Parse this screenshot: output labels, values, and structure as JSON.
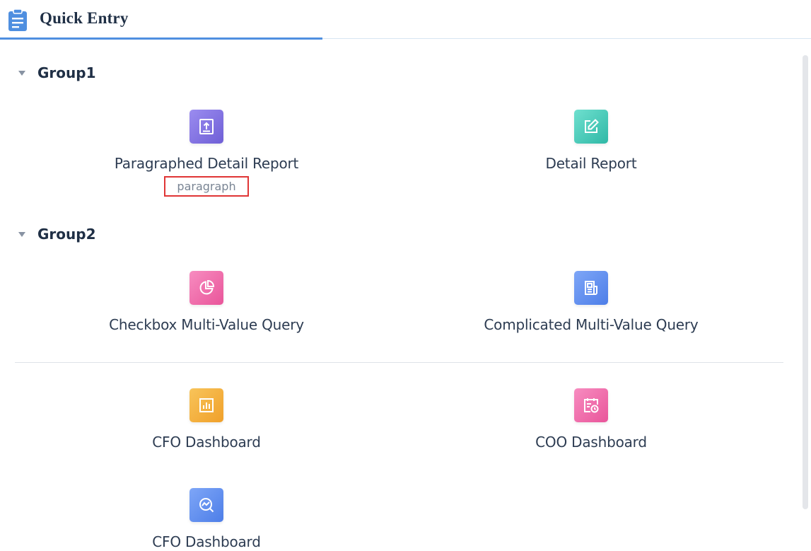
{
  "header": {
    "title": "Quick Entry",
    "icon": "clipboard-list-icon",
    "accent": "#4f8fe0"
  },
  "groups": [
    {
      "label": "Group1",
      "items": [
        {
          "name": "Paragraphed Detail Report",
          "tag": "paragraph",
          "icon": "upload-icon",
          "color": "#7c6fe0"
        },
        {
          "name": "Detail Report",
          "icon": "edit-icon",
          "color": "#3ec9b8"
        }
      ]
    },
    {
      "label": "Group2",
      "items": [
        {
          "name": "Checkbox Multi-Value Query",
          "icon": "pie-chart-icon",
          "color": "#f06aa8"
        },
        {
          "name": "Complicated Multi-Value Query",
          "icon": "newspaper-icon",
          "color": "#5b8cf0"
        }
      ]
    }
  ],
  "ungrouped": [
    {
      "name": "CFO Dashboard",
      "icon": "bar-chart-icon",
      "color": "#f5b03c"
    },
    {
      "name": "COO Dashboard",
      "icon": "calendar-clock-icon",
      "color": "#f06aa8"
    },
    {
      "name": "CFO Dashboard",
      "icon": "search-trend-icon",
      "color": "#5b8cf0"
    }
  ]
}
